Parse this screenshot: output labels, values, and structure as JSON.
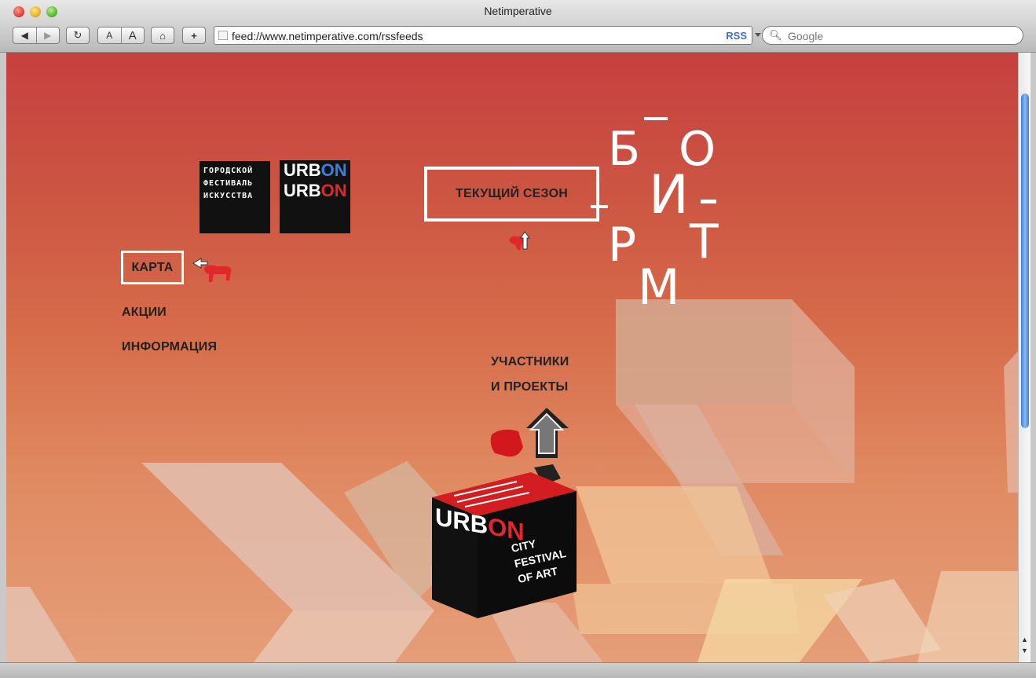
{
  "browser": {
    "window_title": "Netimperative",
    "address_url": "feed://www.netimperative.com/rssfeeds",
    "rss_label": "RSS",
    "search_placeholder": "Google",
    "text_small_label": "A",
    "text_large_label": "A",
    "add_bookmark_label": "+"
  },
  "site": {
    "festival_logo_lines": [
      "ГОРОДСКОЙ",
      "ФЕСТИВАЛЬ",
      "ИСКУССТВА"
    ],
    "urbon_logo": {
      "line1_a": "URB",
      "line1_b": "ON",
      "line2_a": "URB",
      "line2_b": "ON"
    },
    "season_label": "ТЕКУЩИЙ СЕЗОН",
    "nav": {
      "map": "КАРТА",
      "promotions": "АКЦИИ",
      "information": "ИНФОРМАЦИЯ"
    },
    "participants_line1": "УЧАСТНИКИ",
    "participants_line2": "И ПРОЕКТЫ",
    "biorhythm_letters": [
      "Б",
      "О",
      "И",
      "Р",
      "Т",
      "М"
    ],
    "cube": {
      "brand_a": "URB",
      "brand_b": "ON",
      "tagline": [
        "CITY",
        "FESTIVAL",
        "OF ART"
      ]
    }
  },
  "colors": {
    "accent_red": "#e0272a",
    "accent_blue": "#3a7ee0",
    "page_top": "#c64040",
    "page_bottom": "#e59e78"
  },
  "icons": [
    "back-icon",
    "forward-icon",
    "reload-icon",
    "home-icon",
    "search-icon",
    "page-icon",
    "dog-icon",
    "arrow-up-icon"
  ]
}
